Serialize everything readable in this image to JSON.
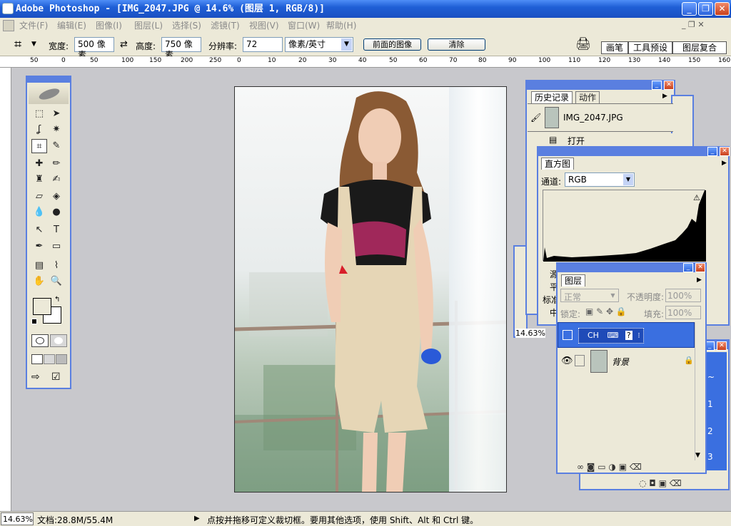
{
  "window": {
    "title": "Adobe Photoshop - [IMG_2047.JPG @ 14.6% (图层 1, RGB/8)]",
    "controls": [
      "_",
      "❐",
      "✕"
    ]
  },
  "menu": [
    "文件(F)",
    "编辑(E)",
    "图像(I)",
    "图层(L)",
    "选择(S)",
    "滤镜(T)",
    "视图(V)",
    "窗口(W)",
    "帮助(H)"
  ],
  "options": {
    "width_label": "宽度:",
    "width_value": "500 像素",
    "height_label": "高度:",
    "height_value": "750 像素",
    "resolution_label": "分辨率:",
    "resolution_value": "72",
    "unit_value": "像素/英寸",
    "front_image_button": "前面的图像",
    "clear_button": "清除",
    "palette_tabs": [
      "画笔",
      "工具预设",
      "图层复合"
    ]
  },
  "ruler_h_labels": [
    "50",
    "0",
    "50",
    "100",
    "150",
    "200",
    "250",
    "0",
    "10",
    "20",
    "30",
    "40",
    "50",
    "60",
    "70",
    "80",
    "90",
    "100",
    "110",
    "120",
    "130",
    "140",
    "150",
    "160"
  ],
  "history": {
    "tabs": [
      "历史记录",
      "动作"
    ],
    "snapshot": "IMG_2047.JPG",
    "open_step": "打开"
  },
  "histogram": {
    "tab": "直方图",
    "channel_label": "通道:",
    "channel_value": "RGB",
    "warning": "⚠",
    "labels": [
      "源",
      "平",
      "标准",
      "中"
    ]
  },
  "layers": {
    "tab": "图层",
    "blend_mode": "正常",
    "opacity_label": "不透明度:",
    "opacity_value": "100%",
    "lock_label": "锁定:",
    "fill_label": "填充:",
    "fill_value": "100%",
    "ime_text": "CH",
    "rows": [
      {
        "name": "",
        "selected": true
      },
      {
        "name": "背景",
        "selected": false
      }
    ]
  },
  "back_panel": {
    "zoom": "14.63%",
    "numbers": [
      "~",
      "1",
      "2",
      "3"
    ]
  },
  "status": {
    "zoom": "14.63%",
    "doc": "文档:28.8M/55.4M",
    "hint": "点按并拖移可定义裁切框。要用其他选项，使用 Shift、Alt 和 Ctrl 键。"
  },
  "colors": {
    "xp_blue": "#5a7fe0",
    "title_blue": "#1f5fd6",
    "panel_bg": "#ece9d8",
    "workspace": "#c8c8cc",
    "selected_layer": "#3a6fe0",
    "histogram_black": "#000000"
  }
}
